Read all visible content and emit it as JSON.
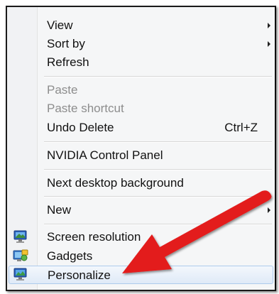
{
  "menu": {
    "items": [
      {
        "label": "View",
        "submenu": true
      },
      {
        "label": "Sort by",
        "submenu": true
      },
      {
        "label": "Refresh"
      },
      {
        "label": "Paste",
        "disabled": true
      },
      {
        "label": "Paste shortcut",
        "disabled": true
      },
      {
        "label": "Undo Delete",
        "shortcut": "Ctrl+Z"
      },
      {
        "label": "NVIDIA Control Panel"
      },
      {
        "label": "Next desktop background"
      },
      {
        "label": "New",
        "submenu": true
      },
      {
        "label": "Screen resolution",
        "icon": "screen-resolution-icon"
      },
      {
        "label": "Gadgets",
        "icon": "gadgets-icon"
      },
      {
        "label": "Personalize",
        "icon": "personalize-icon",
        "highlighted": true
      }
    ]
  },
  "colors": {
    "arrow": "#e31b1b",
    "highlight_border": "#aecbec",
    "disabled_text": "#8d8d8d"
  }
}
